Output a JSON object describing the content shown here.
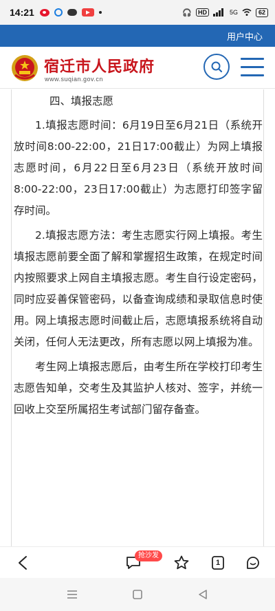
{
  "status_bar": {
    "time": "14:21",
    "network": "HD",
    "signal_text": "5G",
    "battery": "62"
  },
  "header": {
    "user_center": "用户中心",
    "site_name": "宿迁市人民政府",
    "site_url": "www.suqian.gov.cn"
  },
  "article": {
    "section_heading": "四、填报志愿",
    "paragraphs": [
      "1.填报志愿时间：6月19日至6月21日（系统开放时间8:00-22:00，21日17:00截止）为网上填报志愿时间，6月22日至6月23日（系统开放时间8:00-22:00，23日17:00截止）为志愿打印签字留存时间。",
      "2.填报志愿方法：考生志愿实行网上填报。考生填报志愿前要全面了解和掌握招生政策，在规定时间内按照要求上网自主填报志愿。考生自行设定密码，同时应妥善保管密码，以备查询成绩和录取信息时使用。网上填报志愿时间截止后，志愿填报系统将自动关闭，任何人无法更改，所有志愿以网上填报为准。",
      "考生网上填报志愿后，由考生所在学校打印考生志愿告知单，交考生及其监护人核对、签字，并统一回收上交至所属招生考试部门留存备查。"
    ]
  },
  "toolbar": {
    "comment_badge": "抢沙发",
    "tabs_count": "1"
  },
  "colors": {
    "brand_blue": "#2367b4",
    "site_red": "#c8161d"
  },
  "icons": [
    "back-arrow-icon",
    "comment-icon",
    "star-icon",
    "tabs-icon",
    "more-face-icon",
    "search-icon",
    "menu-icon",
    "emblem-icon"
  ]
}
